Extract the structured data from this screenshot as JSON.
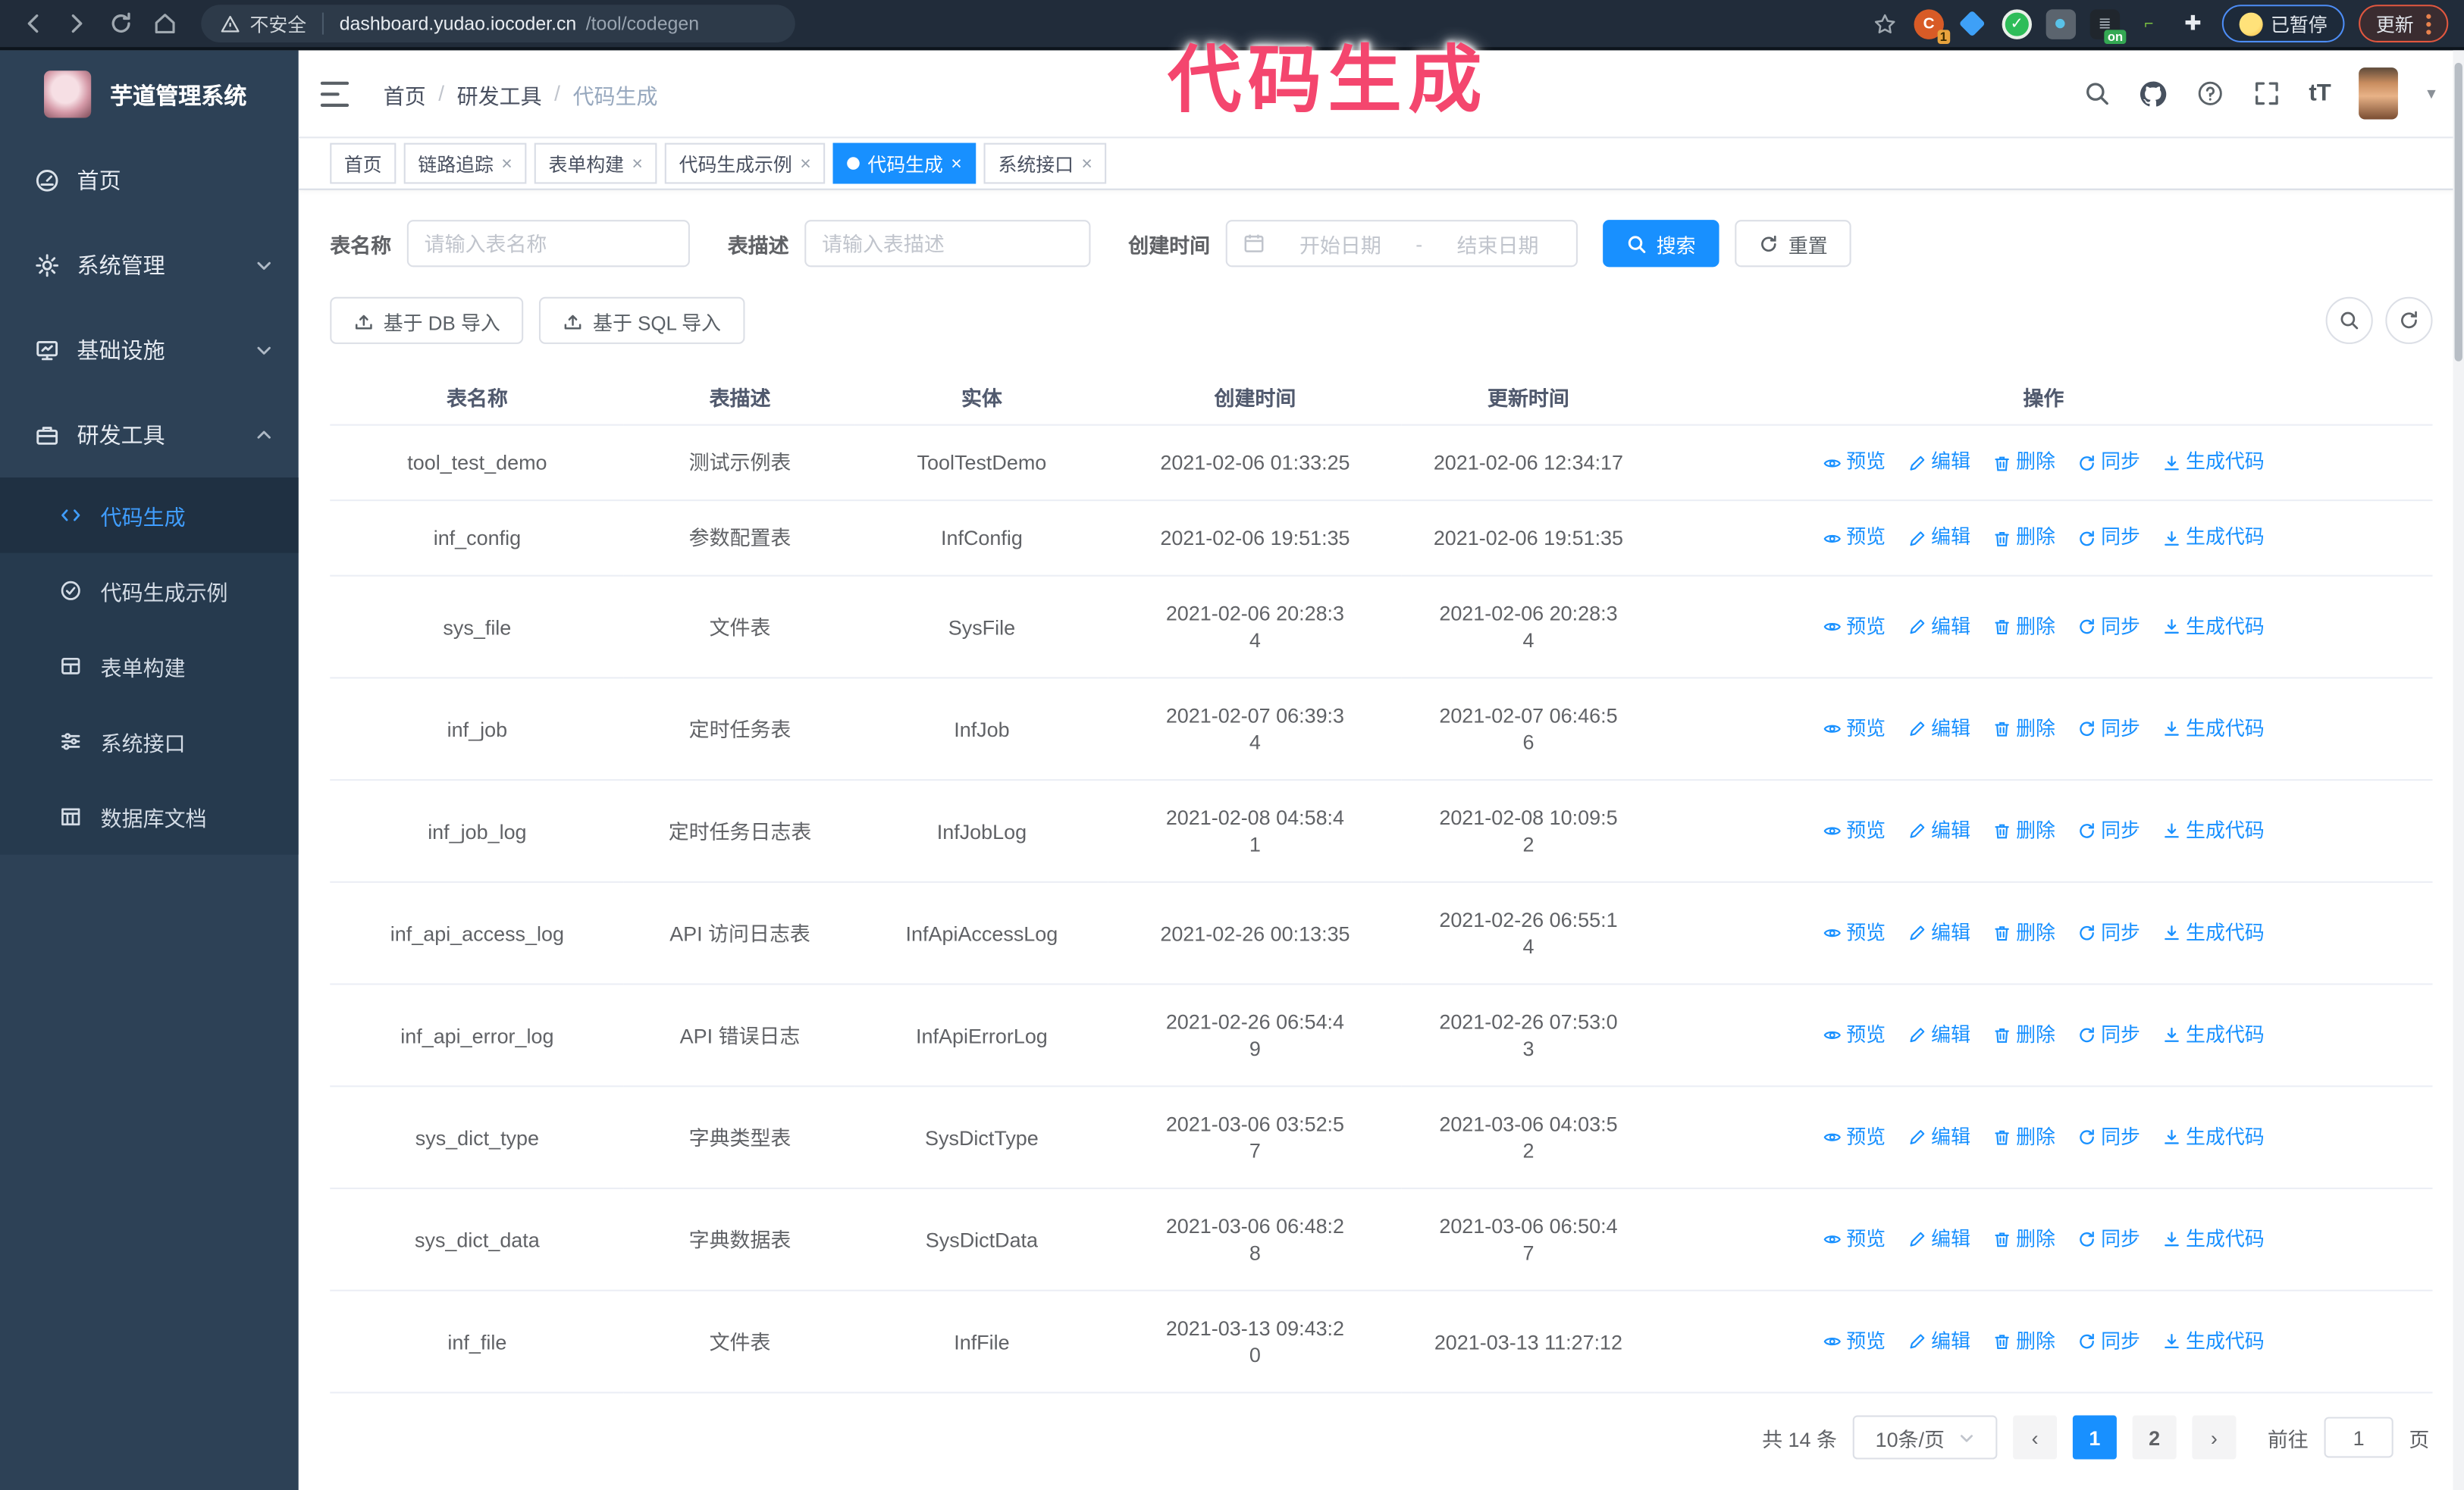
{
  "browser": {
    "security_label": "不安全",
    "url_domain": "dashboard.yudao.iocoder.cn",
    "url_path": "/tool/codegen",
    "extension_badge": "1",
    "extension_on_badge": "on",
    "paused_badge": "已暂停",
    "update_button": "更新"
  },
  "overlay": {
    "title": "代码生成"
  },
  "sidebar": {
    "logo_title": "芋道管理系统",
    "items": [
      {
        "label": "首页"
      },
      {
        "label": "系统管理"
      },
      {
        "label": "基础设施"
      },
      {
        "label": "研发工具"
      }
    ],
    "subitems": [
      {
        "label": "代码生成",
        "active": true
      },
      {
        "label": "代码生成示例"
      },
      {
        "label": "表单构建"
      },
      {
        "label": "系统接口"
      },
      {
        "label": "数据库文档"
      }
    ]
  },
  "header": {
    "breadcrumb": [
      "首页",
      "研发工具",
      "代码生成"
    ]
  },
  "tabs": [
    {
      "label": "首页",
      "closable": false,
      "active": false
    },
    {
      "label": "链路追踪",
      "closable": true,
      "active": false
    },
    {
      "label": "表单构建",
      "closable": true,
      "active": false
    },
    {
      "label": "代码生成示例",
      "closable": true,
      "active": false
    },
    {
      "label": "代码生成",
      "closable": true,
      "active": true
    },
    {
      "label": "系统接口",
      "closable": true,
      "active": false
    }
  ],
  "filters": {
    "table_name_label": "表名称",
    "table_name_placeholder": "请输入表名称",
    "table_desc_label": "表描述",
    "table_desc_placeholder": "请输入表描述",
    "create_time_label": "创建时间",
    "date_start_placeholder": "开始日期",
    "date_separator": "-",
    "date_end_placeholder": "结束日期",
    "search_label": "搜索",
    "reset_label": "重置"
  },
  "toolbar": {
    "import_db_label": "基于 DB 导入",
    "import_sql_label": "基于 SQL 导入"
  },
  "table": {
    "columns": [
      "表名称",
      "表描述",
      "实体",
      "创建时间",
      "更新时间",
      "操作"
    ],
    "actions": [
      "预览",
      "编辑",
      "删除",
      "同步",
      "生成代码"
    ],
    "rows": [
      {
        "name": "tool_test_demo",
        "desc": "测试示例表",
        "entity": "ToolTestDemo",
        "created": "2021-02-06 01:33:25",
        "created_wrapped": false,
        "updated": "2021-02-06 12:34:17",
        "updated_wrapped": false
      },
      {
        "name": "inf_config",
        "desc": "参数配置表",
        "entity": "InfConfig",
        "created": "2021-02-06 19:51:35",
        "created_wrapped": false,
        "updated": "2021-02-06 19:51:35",
        "updated_wrapped": false
      },
      {
        "name": "sys_file",
        "desc": "文件表",
        "entity": "SysFile",
        "created": "2021-02-06 20:28:34",
        "created_wrapped": true,
        "updated": "2021-02-06 20:28:34",
        "updated_wrapped": true
      },
      {
        "name": "inf_job",
        "desc": "定时任务表",
        "entity": "InfJob",
        "created": "2021-02-07 06:39:34",
        "created_wrapped": true,
        "updated": "2021-02-07 06:46:56",
        "updated_wrapped": true
      },
      {
        "name": "inf_job_log",
        "desc": "定时任务日志表",
        "entity": "InfJobLog",
        "created": "2021-02-08 04:58:41",
        "created_wrapped": true,
        "updated": "2021-02-08 10:09:52",
        "updated_wrapped": true
      },
      {
        "name": "inf_api_access_log",
        "desc": "API 访问日志表",
        "entity": "InfApiAccessLog",
        "created": "2021-02-26 00:13:35",
        "created_wrapped": false,
        "updated": "2021-02-26 06:55:14",
        "updated_wrapped": true
      },
      {
        "name": "inf_api_error_log",
        "desc": "API 错误日志",
        "entity": "InfApiErrorLog",
        "created": "2021-02-26 06:54:49",
        "created_wrapped": true,
        "updated": "2021-02-26 07:53:03",
        "updated_wrapped": true
      },
      {
        "name": "sys_dict_type",
        "desc": "字典类型表",
        "entity": "SysDictType",
        "created": "2021-03-06 03:52:57",
        "created_wrapped": true,
        "updated": "2021-03-06 04:03:52",
        "updated_wrapped": true
      },
      {
        "name": "sys_dict_data",
        "desc": "字典数据表",
        "entity": "SysDictData",
        "created": "2021-03-06 06:48:28",
        "created_wrapped": true,
        "updated": "2021-03-06 06:50:47",
        "updated_wrapped": true
      },
      {
        "name": "inf_file",
        "desc": "文件表",
        "entity": "InfFile",
        "created": "2021-03-13 09:43:20",
        "created_wrapped": true,
        "updated": "2021-03-13 11:27:12",
        "updated_wrapped": false
      }
    ]
  },
  "pagination": {
    "total_label": "共 14 条",
    "page_size": "10条/页",
    "pages": [
      "1",
      "2"
    ],
    "active_page": "1",
    "goto_label": "前往",
    "goto_value": "1",
    "page_unit_label": "页"
  },
  "colors": {
    "accent": "#1890ff",
    "sidebar_bg": "#2d4156",
    "active_menu_text": "#409eff",
    "overlay_pink": "#f4466e",
    "chrome_bg": "#212c3a"
  }
}
